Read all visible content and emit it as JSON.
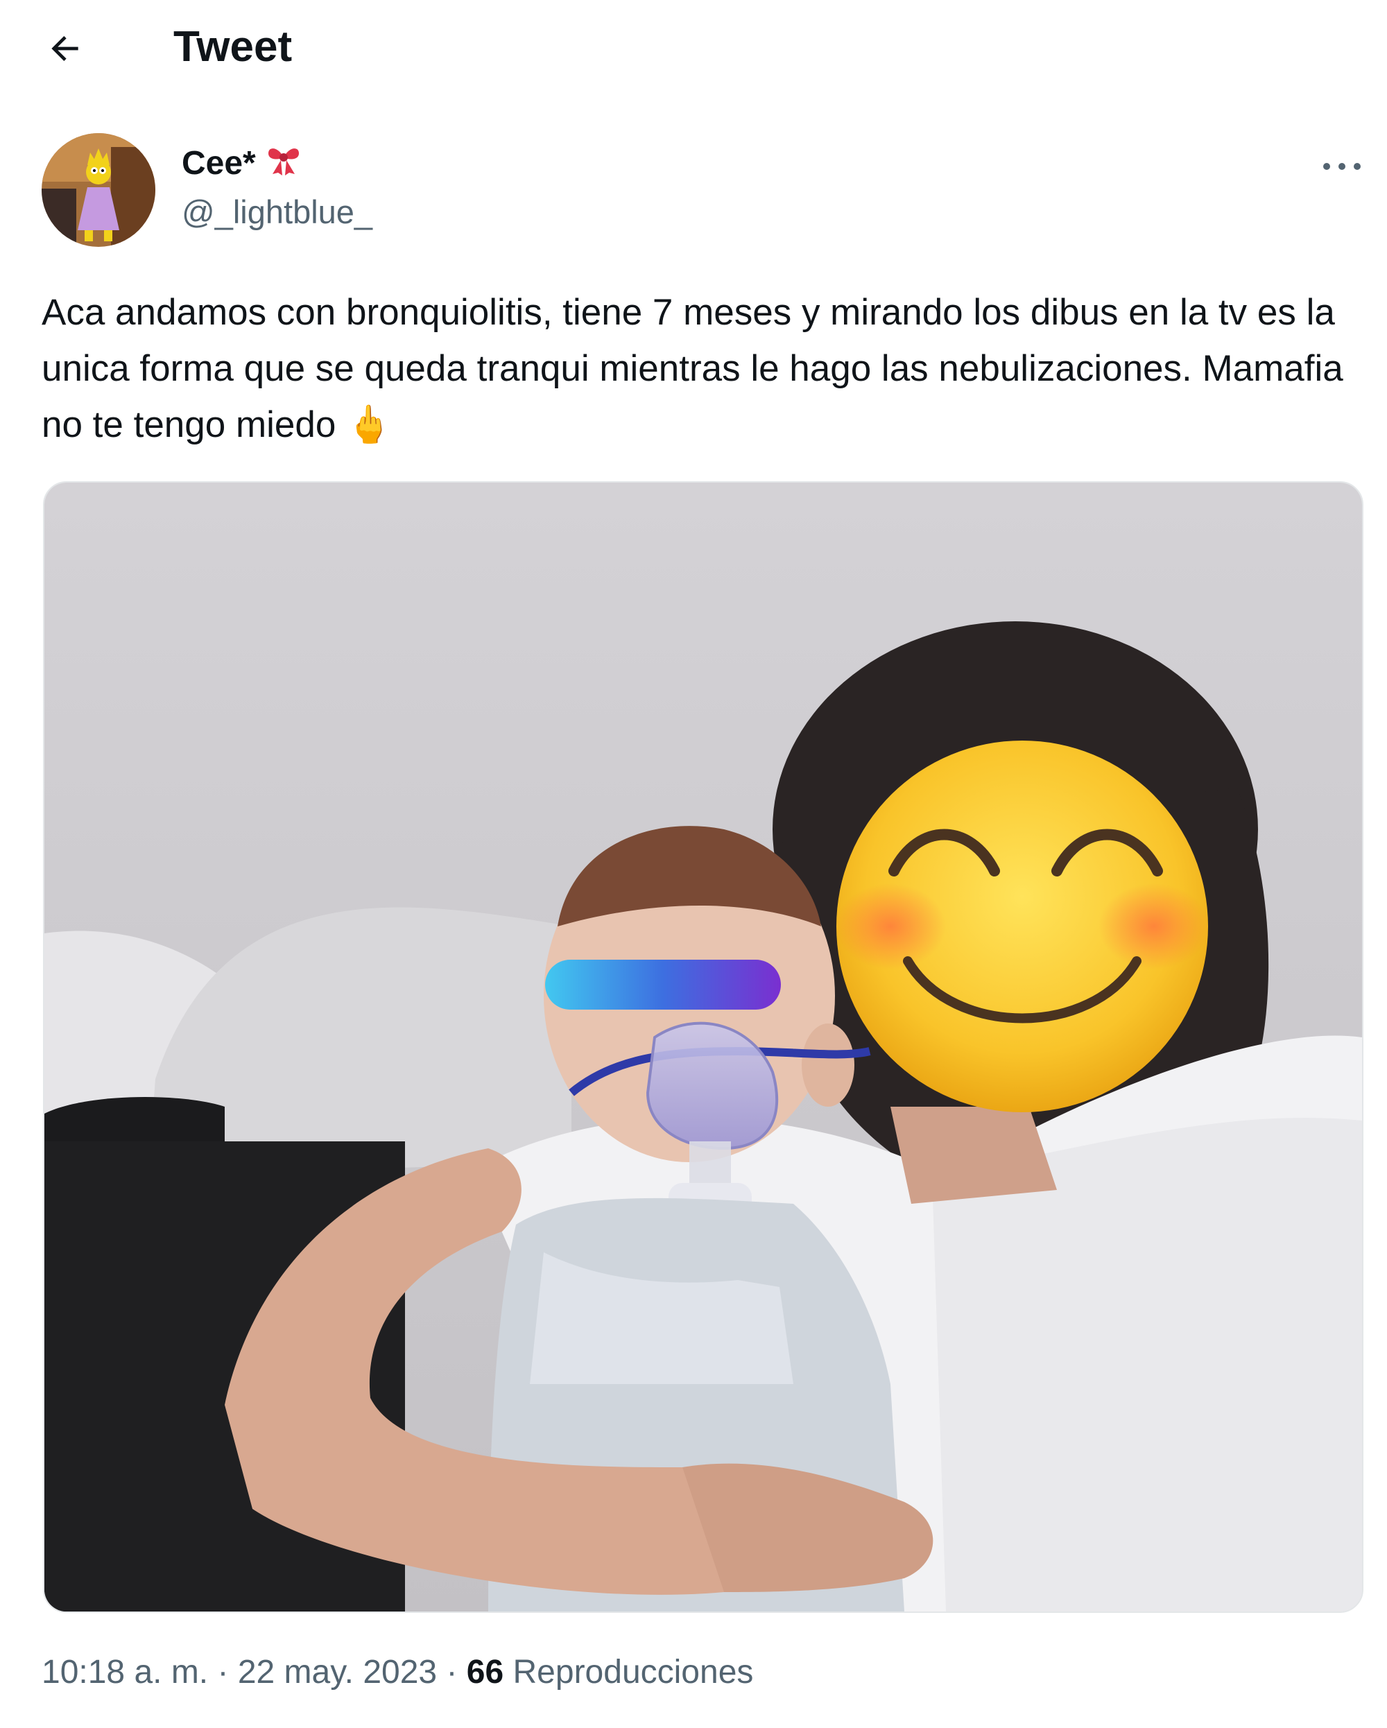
{
  "header": {
    "title": "Tweet"
  },
  "author": {
    "display_name": "Cee*",
    "name_emoji": "🎀",
    "handle": "@_lightblue_"
  },
  "tweet": {
    "text": "Aca andamos con bronquiolitis, tiene 7 meses y mirando los dibus en la tv es la unica forma que se queda tranqui mientras le hago las nebulizaciones. Mamafia no te tengo miedo 🖕"
  },
  "meta": {
    "time": "10:18 a. m.",
    "separator": "·",
    "date": "22 may. 2023",
    "views_count": "66",
    "views_label": "Reproducciones"
  },
  "icons": {
    "back": "arrow-left-icon",
    "more": "more-horizontal-icon"
  },
  "colors": {
    "text_primary": "#0f1419",
    "text_secondary": "#536471",
    "border": "#e3e6e8"
  }
}
